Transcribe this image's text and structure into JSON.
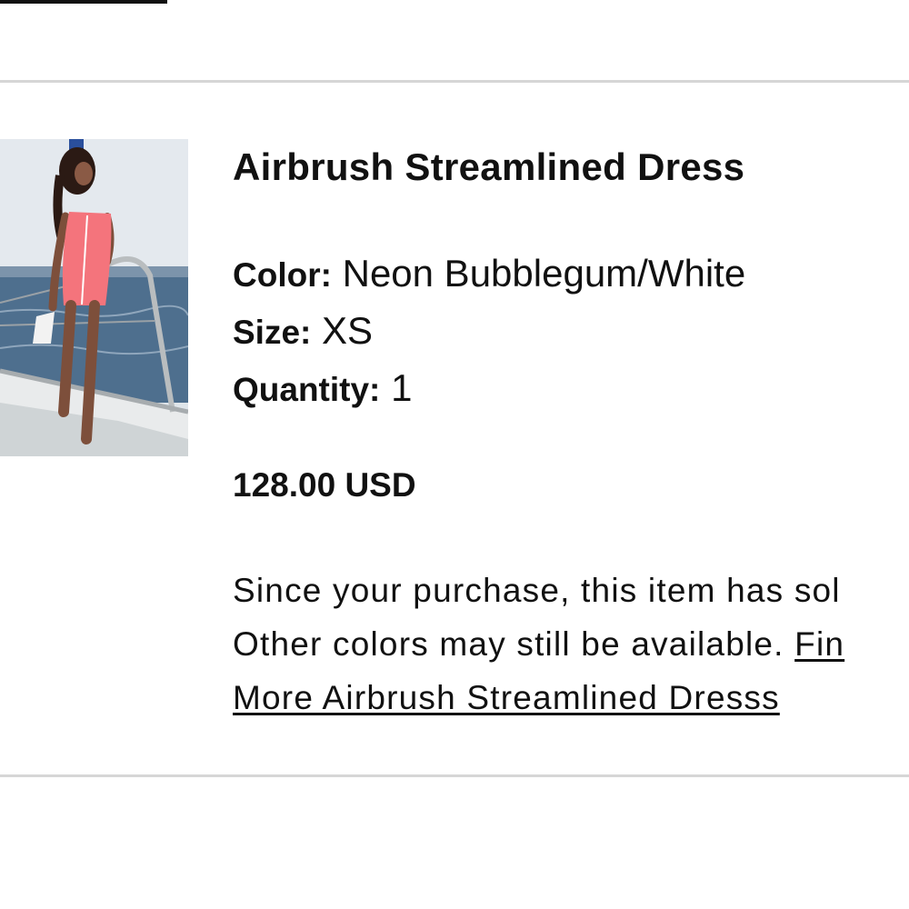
{
  "order_item": {
    "title": "Airbrush Streamlined Dress",
    "image_alt": "Model wearing pink dress on a sailboat",
    "attributes": {
      "color_label": "Color:",
      "color_value": "Neon Bubblegum/White",
      "size_label": "Size:",
      "size_value": "XS",
      "quantity_label": "Quantity:",
      "quantity_value": "1"
    },
    "price": "128.00 USD",
    "notice": {
      "line1": "Since your purchase, this item has sol",
      "line2_text": "Other colors may still be available. ",
      "line2_link": "Fin",
      "line3_link": "More Airbrush Streamlined Dresss"
    }
  },
  "colors": {
    "text": "#111111",
    "divider": "#d6d6d6",
    "dress": "#f4747c"
  }
}
